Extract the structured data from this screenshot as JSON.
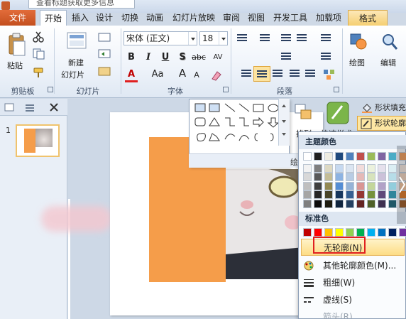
{
  "tip_text": "查看标题获取更多信息",
  "tabs": {
    "file": "文件",
    "start": "开始",
    "insert": "插入",
    "design": "设计",
    "transition": "切换",
    "animation": "动画",
    "slideshow": "幻灯片放映",
    "review": "审阅",
    "view": "视图",
    "developer": "开发工具",
    "addins": "加载项",
    "format": "格式"
  },
  "ribbon": {
    "paste": "粘贴",
    "clipboard": "剪贴板",
    "new_slide_1": "新建",
    "new_slide_2": "幻灯片",
    "slides": "幻灯片",
    "font_name": "宋体 (正文)",
    "font_size": "18",
    "font_group": "字体",
    "paragraph": "段落",
    "drawing": "绘图",
    "editing": "编辑",
    "bold": "B",
    "italic": "I",
    "underline": "U",
    "shadow": "S",
    "strike": "abc",
    "spacing": "AV",
    "case": "Aa",
    "grow": "A",
    "shrink": "A",
    "font_color": "A"
  },
  "format_commands": {
    "shape_fill": "形状填充",
    "shape_outline": "形状轮廓",
    "arrange": "排列",
    "quick_styles": "快速样式",
    "drawing_label": "绘"
  },
  "slide_pane": {
    "slide_number": "1"
  },
  "color_menu": {
    "theme_header": "主题颜色",
    "standard_header": "标准色",
    "no_outline": "无轮廓(N)",
    "more_colors": "其他轮廓颜色(M)...",
    "weight": "粗细(W)",
    "dashes": "虚线(S)",
    "arrows": "箭头(R)",
    "theme_colors": [
      [
        "#ffffff",
        "#1f1f1f",
        "#eeece1",
        "#1f497d",
        "#4f81bd",
        "#c0504d",
        "#9bbb59",
        "#8064a2",
        "#4bacc6",
        "#f79646"
      ],
      [
        "#f2f2f2",
        "#7f7f7f",
        "#ddd9c3",
        "#c6d9f0",
        "#dbe5f1",
        "#f2dcdb",
        "#ebf1dd",
        "#e5e0ec",
        "#dbeef3",
        "#fdeada"
      ],
      [
        "#d8d8d8",
        "#595959",
        "#c4bd97",
        "#8db3e2",
        "#b8cce4",
        "#e5b9b7",
        "#d7e3bc",
        "#ccc1d9",
        "#b7dde8",
        "#fbd5b5"
      ],
      [
        "#bfbfbf",
        "#3f3f3f",
        "#938953",
        "#548dd4",
        "#95b3d7",
        "#d99694",
        "#c3d69b",
        "#b2a2c7",
        "#92cddc",
        "#fac08f"
      ],
      [
        "#a5a5a5",
        "#262626",
        "#494429",
        "#17365d",
        "#366092",
        "#953734",
        "#76923c",
        "#5f497a",
        "#31859b",
        "#e36c09"
      ],
      [
        "#7f7f7f",
        "#0c0c0c",
        "#1d1b10",
        "#0f243e",
        "#244061",
        "#632423",
        "#4f6128",
        "#3f3151",
        "#205867",
        "#974806"
      ]
    ],
    "standard_colors": [
      "#c00000",
      "#ff0000",
      "#ffc000",
      "#ffff00",
      "#92d050",
      "#00b050",
      "#00b0f0",
      "#0070c0",
      "#002060",
      "#7030a0"
    ]
  }
}
